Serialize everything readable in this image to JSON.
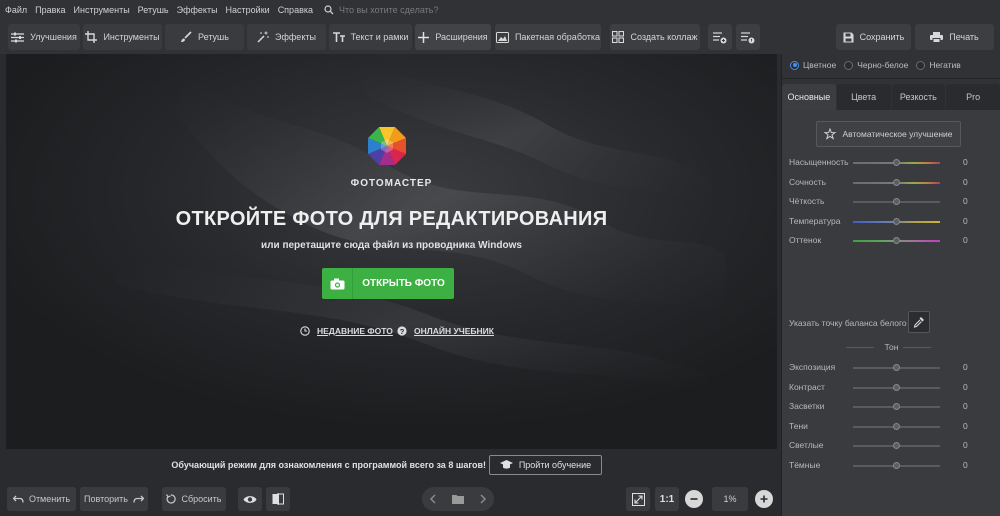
{
  "menu": {
    "items": [
      "Файл",
      "Правка",
      "Инструменты",
      "Ретушь",
      "Эффекты",
      "Настройки",
      "Справка"
    ],
    "search_placeholder": "Что вы хотите сделать?"
  },
  "toolbar": {
    "tabs": [
      {
        "label": "Улучшения",
        "icon": "sliders-icon"
      },
      {
        "label": "Инструменты",
        "icon": "crop-icon"
      },
      {
        "label": "Ретушь",
        "icon": "brush-icon"
      },
      {
        "label": "Эффекты",
        "icon": "magic-wand-icon"
      },
      {
        "label": "Текст и рамки",
        "icon": "text-icon"
      },
      {
        "label": "Расширения",
        "icon": "plus-icon"
      }
    ],
    "batch_label": "Пакетная обработка",
    "collage_label": "Создать коллаж",
    "save_label": "Сохранить",
    "print_label": "Печать"
  },
  "canvas": {
    "brand": "ФОТОМАСТЕР",
    "headline": "ОТКРОЙТЕ ФОТО ДЛЯ РЕДАКТИРОВАНИЯ",
    "subline": "или перетащите сюда файл из проводника Windows",
    "open_label": "ОТКРЫТЬ ФОТО",
    "recent_label": "НЕДАВНИЕ ФОТО",
    "tutorial_link": "ОНЛАЙН УЧЕБНИК",
    "accent": "#3cb043"
  },
  "tutorial": {
    "text": "Обучающий режим для ознакомления с программой всего за 8 шагов!",
    "button": "Пройти обучение"
  },
  "bottom": {
    "undo_label": "Отменить",
    "redo_label": "Повторить",
    "reset_label": "Сбросить",
    "ratio_label": "1:1",
    "zoom_value": "1%"
  },
  "panel": {
    "modes": [
      "Цветное",
      "Черно-белое",
      "Негатив"
    ],
    "selected_mode": "Цветное",
    "tabs": [
      "Основные",
      "Цвета",
      "Резкость",
      "Pro"
    ],
    "active_tab": "Основные",
    "auto_label": "Автоматическое улучшение",
    "sliders": [
      {
        "name": "Насыщенность",
        "value": "0",
        "gradient": "linear-gradient(90deg,#6b6b6b,#7a7a7a 50%,#9aa84a 70%,#c08040 85%,#b04060)"
      },
      {
        "name": "Сочность",
        "value": "0",
        "gradient": "linear-gradient(90deg,#6b6b6b,#7a7a7a 50%,#9aa84a 70%,#c08040 85%,#b04060)"
      },
      {
        "name": "Чёткость",
        "value": "0",
        "gradient": "linear-gradient(90deg,#5a5b5f,#5a5b5f)"
      },
      {
        "name": "Температура",
        "value": "0",
        "gradient": "linear-gradient(90deg,#4060c0,#7080b0 45%,#b0a050 70%,#d0b030)"
      },
      {
        "name": "Оттенок",
        "value": "0",
        "gradient": "linear-gradient(90deg,#40a040,#70a070 45%,#a070a0 70%,#c040c0)"
      }
    ],
    "wb_label": "Указать точку баланса белого",
    "tone_label": "Тон",
    "tone_sliders": [
      {
        "name": "Экспозиция",
        "value": "0"
      },
      {
        "name": "Контраст",
        "value": "0"
      },
      {
        "name": "Засветки",
        "value": "0"
      },
      {
        "name": "Тени",
        "value": "0"
      },
      {
        "name": "Светлые",
        "value": "0"
      },
      {
        "name": "Тёмные",
        "value": "0"
      }
    ]
  }
}
